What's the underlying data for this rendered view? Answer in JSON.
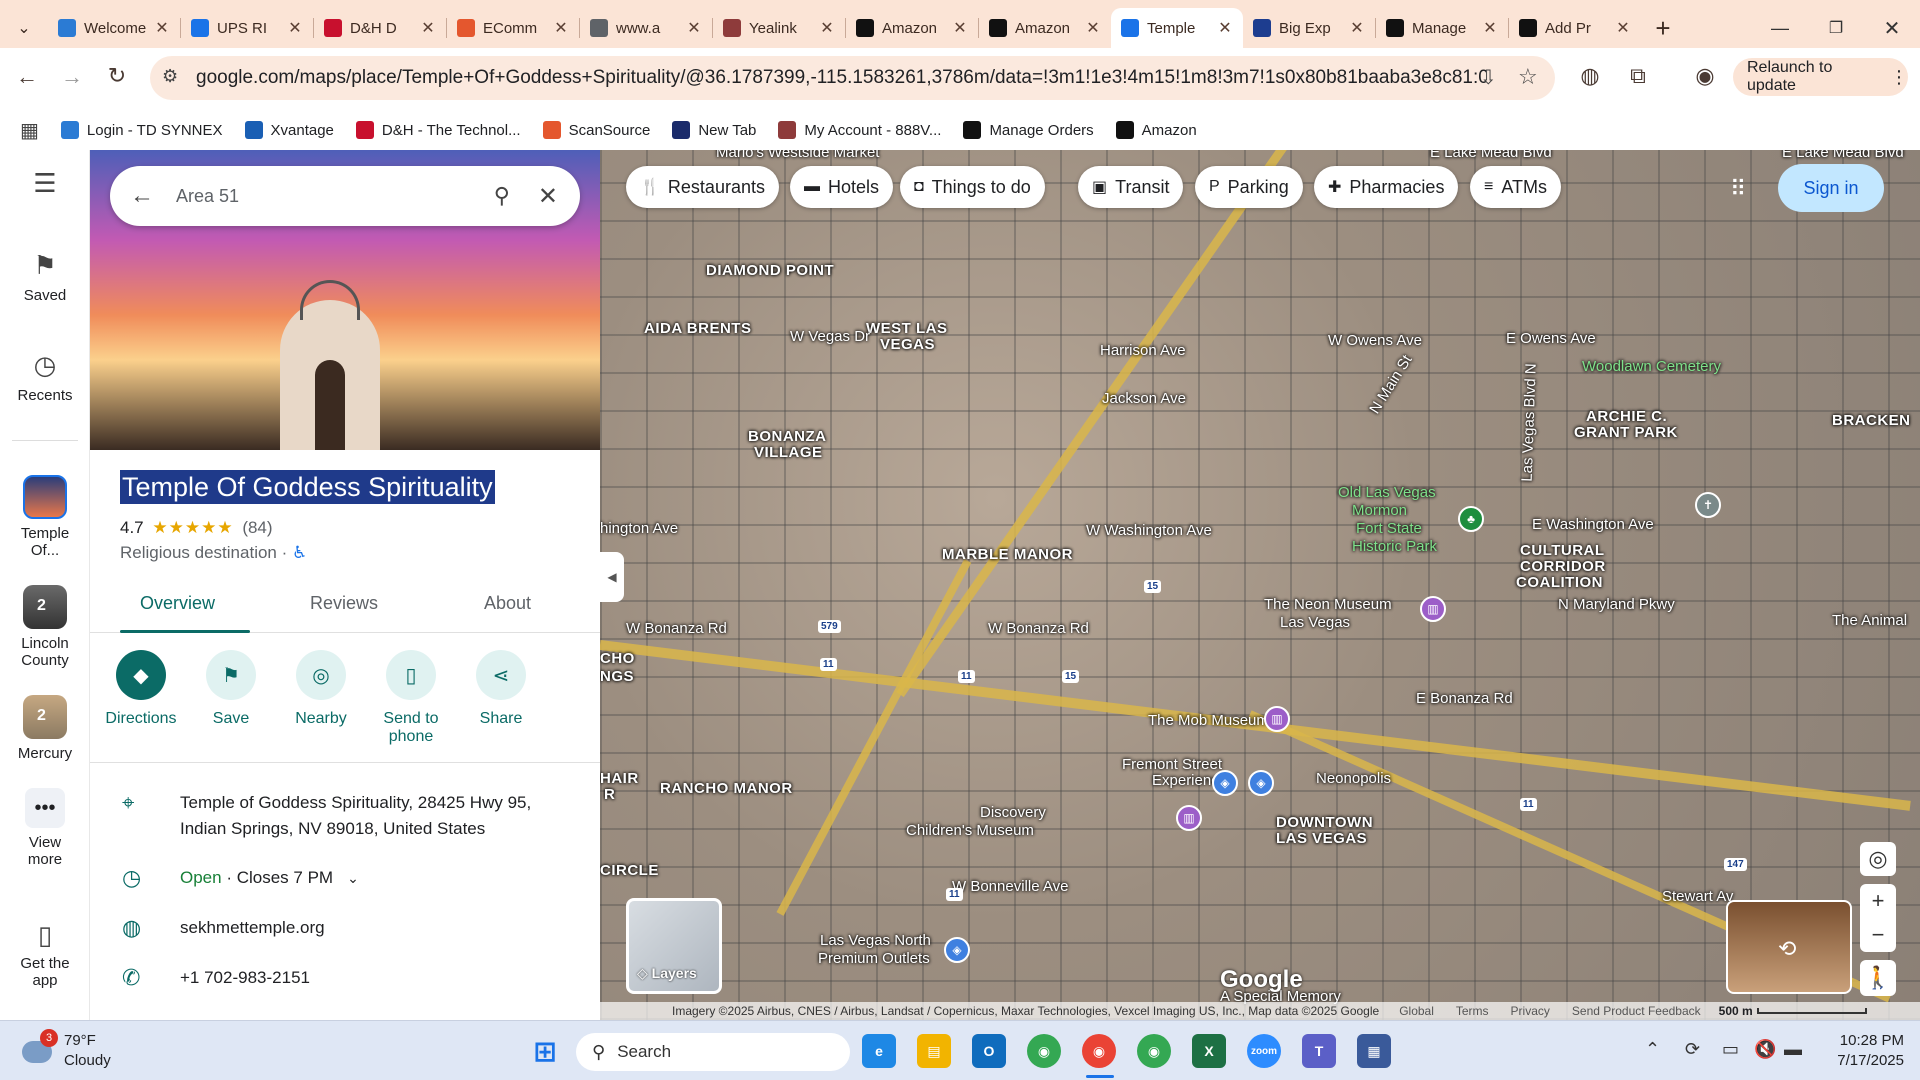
{
  "browser": {
    "tabs": [
      {
        "title": "Welcome",
        "icon": "ec-icon",
        "color": "#2b7bd4"
      },
      {
        "title": "UPS RI",
        "icon": "ups-icon",
        "color": "#1a73e8"
      },
      {
        "title": "D&H D",
        "icon": "dh-icon",
        "color": "#c8102e"
      },
      {
        "title": "EComm",
        "icon": "scansource-icon",
        "color": "#e4572e"
      },
      {
        "title": "www.a",
        "icon": "globe-icon",
        "color": "#5f6368"
      },
      {
        "title": "Yealink",
        "icon": "yealink-icon",
        "color": "#8e3b3b"
      },
      {
        "title": "Amazon",
        "icon": "amazon-icon",
        "color": "#111"
      },
      {
        "title": "Amazon",
        "icon": "amazon-icon",
        "color": "#111"
      },
      {
        "title": "Temple",
        "icon": "maps-pin-icon",
        "color": "#1a73e8",
        "active": true
      },
      {
        "title": "Big Exp",
        "icon": "star-icon",
        "color": "#1d3d8f"
      },
      {
        "title": "Manage",
        "icon": "amazon-icon",
        "color": "#111"
      },
      {
        "title": "Add Pr",
        "icon": "amazon-icon",
        "color": "#111"
      }
    ],
    "url": "google.com/maps/place/Temple+Of+Goddess+Spirituality/@36.1787399,-115.1583261,3786m/data=!3m1!1e3!4m15!1m8!3m7!1s0x80b81baaba3e8c81:0x970427...",
    "relaunch_label": "Relaunch to update",
    "bookmarks": [
      {
        "label": "Login - TD SYNNEX",
        "color": "#2b7bd4"
      },
      {
        "label": "Xvantage",
        "color": "#1a5fb4"
      },
      {
        "label": "D&H - The Technol...",
        "color": "#c8102e"
      },
      {
        "label": "ScanSource",
        "color": "#e4572e"
      },
      {
        "label": "New Tab",
        "color": "#1a2b6b"
      },
      {
        "label": "My Account - 888V...",
        "color": "#8e3b3b"
      },
      {
        "label": "Manage Orders",
        "color": "#111"
      },
      {
        "label": "Amazon",
        "color": "#111"
      }
    ]
  },
  "rail": {
    "saved": "Saved",
    "recents": "Recents",
    "items": [
      {
        "label1": "Temple",
        "label2": "Of..."
      },
      {
        "label1": "Lincoln",
        "label2": "County",
        "badge": "2"
      },
      {
        "label1": "Mercury",
        "label2": "",
        "badge": "2"
      }
    ],
    "view_more1": "View",
    "view_more2": "more",
    "get_app1": "Get the",
    "get_app2": "app"
  },
  "panel": {
    "search_value": "Area 51",
    "title": "Temple Of Goddess Spirituality",
    "rating": "4.7",
    "stars": "★★★★★",
    "reviews": "(84)",
    "category": "Religious destination ·",
    "accessible_icon": "♿",
    "tabs": [
      "Overview",
      "Reviews",
      "About"
    ],
    "actions": [
      {
        "label1": "Directions",
        "label2": "",
        "icon": "◆"
      },
      {
        "label1": "Save",
        "label2": "",
        "icon": "⚑"
      },
      {
        "label1": "Nearby",
        "label2": "",
        "icon": "◎"
      },
      {
        "label1": "Send to",
        "label2": "phone",
        "icon": "▯"
      },
      {
        "label1": "Share",
        "label2": "",
        "icon": "⋖"
      }
    ],
    "address1": "Temple of Goddess Spirituality, 28425 Hwy 95,",
    "address2": "Indian Springs, NV 89018, United States",
    "open": "Open",
    "closes": " · Closes 7 PM",
    "website": "sekhmettemple.org",
    "phone": "+1 702-983-2151"
  },
  "map": {
    "chips": [
      "Restaurants",
      "Hotels",
      "Things to do",
      "Transit",
      "Parking",
      "Pharmacies",
      "ATMs"
    ],
    "signin": "Sign in",
    "layers": "Layers",
    "attribution": "Imagery ©2025 Airbus, CNES / Airbus, Landsat / Copernicus, Maxar Technologies, Vexcel Imaging US, Inc., Map data ©2025 Google",
    "attr_links": [
      "Global",
      "Terms",
      "Privacy",
      "Send Product Feedback"
    ],
    "scale": "500 m",
    "google": "Google",
    "labels": {
      "diamond_point": "DIAMOND POINT",
      "aida_brents": "AIDA BRENTS",
      "west_las_vegas1": "WEST LAS",
      "west_las_vegas2": "VEGAS",
      "w_vegas_dr": "W Vegas Dr",
      "bonanza_village1": "BONANZA",
      "bonanza_village2": "VILLAGE",
      "harrison": "Harrison Ave",
      "jackson": "Jackson Ave",
      "w_owens": "W Owens Ave",
      "e_owens": "E Owens Ave",
      "woodlawn": "Woodlawn Cemetery",
      "archie1": "ARCHIE C.",
      "archie2": "GRANT PARK",
      "bracken": "BRACKEN",
      "washington_w": "hington Ave",
      "w_washington": "W Washington Ave",
      "e_washington": "E Washington Ave",
      "marble_manor": "MARBLE MANOR",
      "old_lv1": "Old Las Vegas",
      "old_lv2": "Mormon",
      "old_lv3": "Fort State",
      "old_lv4": "Historic Park",
      "cultural1": "CULTURAL",
      "cultural2": "CORRIDOR",
      "cultural3": "COALITION",
      "maryland": "N Maryland Pkwy",
      "neon1": "The Neon Museum",
      "neon2": "Las Vegas",
      "animal": "The Animal",
      "w_bonanza1": "W Bonanza Rd",
      "w_bonanza2": "W Bonanza Rd",
      "e_bonanza": "E Bonanza Rd",
      "cho": "CHO",
      "ngs": "NGS",
      "mob": "The Mob Museum",
      "fremont1": "Fremont Street",
      "fremont2": "Experience",
      "neonopolis": "Neonopolis",
      "rancho_manor": "RANCHO MANOR",
      "hair": "HAIR",
      "r": "R",
      "discovery1": "Discovery",
      "discovery2": "Children's Museum",
      "downtown1": "DOWNTOWN",
      "downtown2": "LAS VEGAS",
      "circle": "CIRCLE",
      "w_bonneville": "W Bonneville Ave",
      "premium1": "Las Vegas North",
      "premium2": "Premium Outlets",
      "special": "A Special Memory",
      "stewart": "Stewart Av",
      "marios": "Mario's Westside Market",
      "e_lake_mead": "E Lake Mead Blvd",
      "e_lake_mead2": "E Lake Mead Blvd",
      "main_st": "N Main St",
      "lv_blvd": "Las Vegas Blvd N"
    },
    "highway_shields": [
      "15",
      "579",
      "11",
      "11",
      "15",
      "11",
      "11",
      "147"
    ]
  },
  "taskbar": {
    "weather_temp": "79°F",
    "weather_desc": "Cloudy",
    "weather_badge": "3",
    "search": "Search",
    "time": "10:28 PM",
    "date": "7/17/2025"
  }
}
